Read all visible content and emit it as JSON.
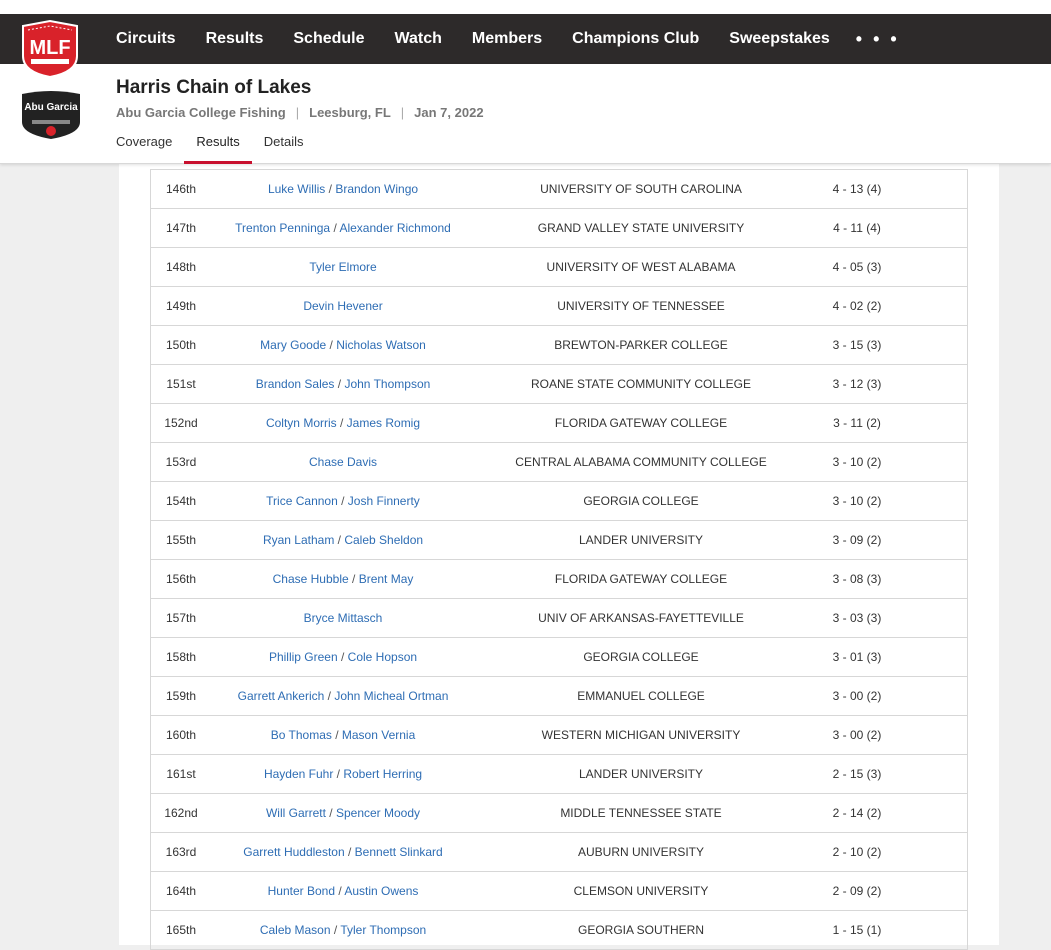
{
  "nav": {
    "brand_text": "MLF",
    "items": [
      "Circuits",
      "Results",
      "Schedule",
      "Watch",
      "Members",
      "Champions Club",
      "Sweepstakes"
    ],
    "more_label": "• • •"
  },
  "event": {
    "sponsor_logo_text": "Abu Garcia",
    "title": "Harris Chain of Lakes",
    "series": "Abu Garcia College Fishing",
    "location": "Leesburg, FL",
    "date": "Jan 7, 2022",
    "separator": "|"
  },
  "tabs": [
    "Coverage",
    "Results",
    "Details"
  ],
  "active_tab": "Results",
  "colors": {
    "nav_bg": "#2d2a2a",
    "accent": "#c8102e",
    "link": "#2e6db4"
  },
  "results": [
    {
      "place": "146th",
      "anglers": [
        "Luke Willis",
        "Brandon Wingo"
      ],
      "school": "UNIVERSITY OF SOUTH CAROLINA",
      "weight": "4 - 13 (4)"
    },
    {
      "place": "147th",
      "anglers": [
        "Trenton Penninga",
        "Alexander Richmond"
      ],
      "school": "GRAND VALLEY STATE UNIVERSITY",
      "weight": "4 - 11 (4)"
    },
    {
      "place": "148th",
      "anglers": [
        "Tyler Elmore"
      ],
      "school": "UNIVERSITY OF WEST ALABAMA",
      "weight": "4 - 05 (3)"
    },
    {
      "place": "149th",
      "anglers": [
        "Devin Hevener"
      ],
      "school": "UNIVERSITY OF TENNESSEE",
      "weight": "4 - 02 (2)"
    },
    {
      "place": "150th",
      "anglers": [
        "Mary Goode",
        "Nicholas Watson"
      ],
      "school": "BREWTON-PARKER COLLEGE",
      "weight": "3 - 15 (3)"
    },
    {
      "place": "151st",
      "anglers": [
        "Brandon Sales",
        "John Thompson"
      ],
      "school": "ROANE STATE COMMUNITY COLLEGE",
      "weight": "3 - 12 (3)"
    },
    {
      "place": "152nd",
      "anglers": [
        "Coltyn Morris",
        "James Romig"
      ],
      "school": "FLORIDA GATEWAY COLLEGE",
      "weight": "3 - 11 (2)"
    },
    {
      "place": "153rd",
      "anglers": [
        "Chase Davis"
      ],
      "school": "CENTRAL ALABAMA COMMUNITY COLLEGE",
      "weight": "3 - 10 (2)"
    },
    {
      "place": "154th",
      "anglers": [
        "Trice Cannon",
        "Josh Finnerty"
      ],
      "school": "GEORGIA COLLEGE",
      "weight": "3 - 10 (2)"
    },
    {
      "place": "155th",
      "anglers": [
        "Ryan Latham",
        "Caleb Sheldon"
      ],
      "school": "LANDER UNIVERSITY",
      "weight": "3 - 09 (2)"
    },
    {
      "place": "156th",
      "anglers": [
        "Chase Hubble",
        "Brent May"
      ],
      "school": "FLORIDA GATEWAY COLLEGE",
      "weight": "3 - 08 (3)"
    },
    {
      "place": "157th",
      "anglers": [
        "Bryce Mittasch"
      ],
      "school": "UNIV OF ARKANSAS-FAYETTEVILLE",
      "weight": "3 - 03 (3)"
    },
    {
      "place": "158th",
      "anglers": [
        "Phillip Green",
        "Cole Hopson"
      ],
      "school": "GEORGIA COLLEGE",
      "weight": "3 - 01 (3)"
    },
    {
      "place": "159th",
      "anglers": [
        "Garrett Ankerich",
        "John Micheal Ortman"
      ],
      "school": "EMMANUEL COLLEGE",
      "weight": "3 - 00 (2)"
    },
    {
      "place": "160th",
      "anglers": [
        "Bo Thomas",
        "Mason Vernia"
      ],
      "school": "WESTERN MICHIGAN UNIVERSITY",
      "weight": "3 - 00 (2)"
    },
    {
      "place": "161st",
      "anglers": [
        "Hayden Fuhr",
        "Robert Herring"
      ],
      "school": "LANDER UNIVERSITY",
      "weight": "2 - 15 (3)"
    },
    {
      "place": "162nd",
      "anglers": [
        "Will Garrett",
        "Spencer Moody"
      ],
      "school": "MIDDLE TENNESSEE STATE",
      "weight": "2 - 14 (2)"
    },
    {
      "place": "163rd",
      "anglers": [
        "Garrett Huddleston",
        "Bennett Slinkard"
      ],
      "school": "AUBURN UNIVERSITY",
      "weight": "2 - 10 (2)"
    },
    {
      "place": "164th",
      "anglers": [
        "Hunter Bond",
        "Austin Owens"
      ],
      "school": "CLEMSON UNIVERSITY",
      "weight": "2 - 09 (2)"
    },
    {
      "place": "165th",
      "anglers": [
        "Caleb Mason",
        "Tyler Thompson"
      ],
      "school": "GEORGIA SOUTHERN",
      "weight": "1 - 15 (1)"
    }
  ]
}
